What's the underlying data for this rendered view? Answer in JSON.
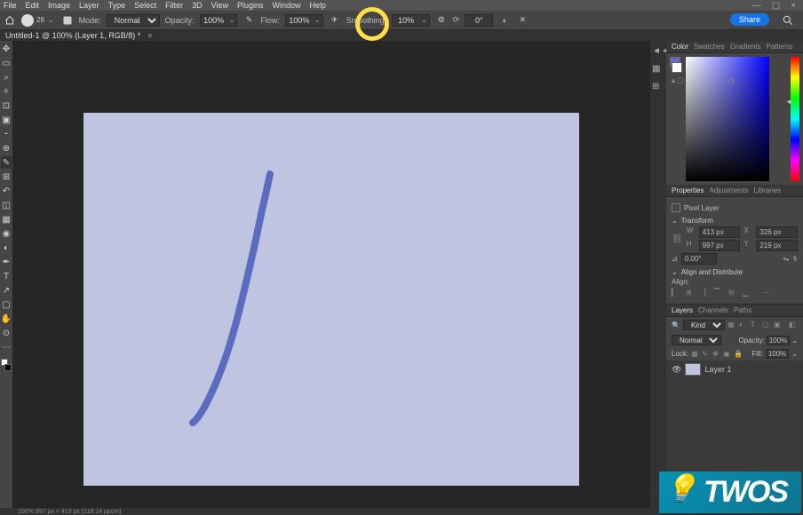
{
  "menu": {
    "items": [
      "File",
      "Edit",
      "Image",
      "Layer",
      "Type",
      "Select",
      "Filter",
      "3D",
      "View",
      "Plugins",
      "Window",
      "Help"
    ]
  },
  "window": {
    "minimize": "—",
    "maximize": "▢",
    "close": "×"
  },
  "options": {
    "brush_size": "26",
    "mode_label": "Mode:",
    "mode_value": "Normal",
    "opacity_label": "Opacity:",
    "opacity_value": "100%",
    "flow_label": "Flow:",
    "flow_value": "100%",
    "smoothing_label": "Smoothing:",
    "smoothing_value": "10%",
    "angle_label": "⟳",
    "angle_value": "0°",
    "share": "Share"
  },
  "doctab": {
    "title": "Untitled-1 @ 100% (Layer 1, RGB/8) *",
    "close": "×"
  },
  "color_panel": {
    "tabs": [
      "Color",
      "Swatches",
      "Gradients",
      "Patterns"
    ],
    "active_tab": "Color"
  },
  "properties_panel": {
    "tabs": [
      "Properties",
      "Adjustments",
      "Libraries"
    ],
    "active_tab": "Properties",
    "pixel_layer": "Pixel Layer",
    "transform": {
      "header": "Transform",
      "w_label": "W",
      "w_value": "413 px",
      "h_label": "H",
      "h_value": "997 px",
      "x_label": "X",
      "x_value": "326 px",
      "y_label": "Y",
      "y_value": "219 px",
      "rotate_value": "0.00°",
      "flip_h": "⇋",
      "flip_v": "⥮"
    },
    "align": {
      "header": "Align and Distribute",
      "label": "Align:"
    }
  },
  "layers_panel": {
    "tabs": [
      "Layers",
      "Channels",
      "Paths"
    ],
    "active_tab": "Layers",
    "kind_label": "Kind",
    "blend_mode": "Normal",
    "opacity_label": "Opacity:",
    "opacity_value": "100%",
    "lock_label": "Lock:",
    "fill_label": "Fill:",
    "fill_value": "100%",
    "layer1": "Layer 1"
  },
  "statusbar": {
    "text": "100%     997 px × 413 px (118.14 ppcm)"
  },
  "watermark": "TWOS"
}
